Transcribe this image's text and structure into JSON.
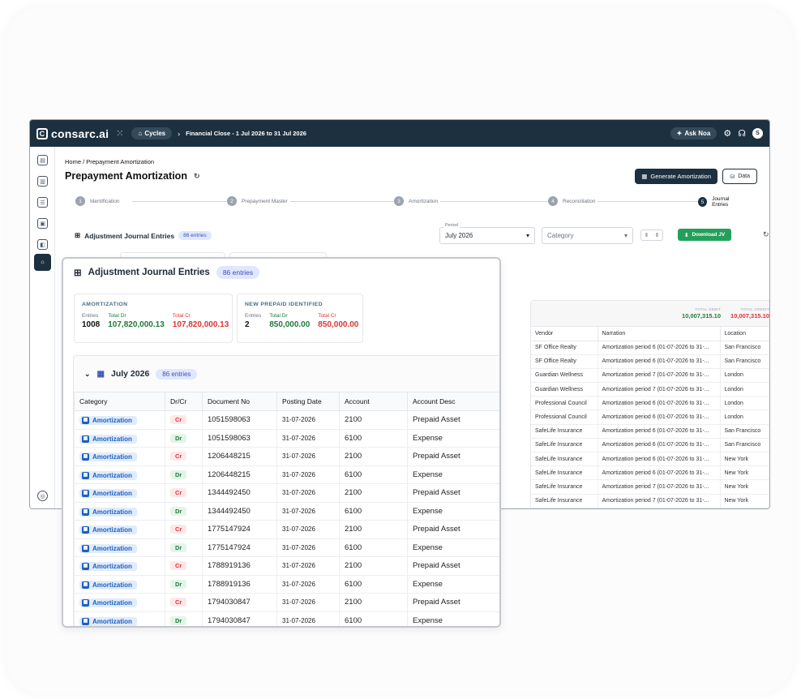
{
  "app": {
    "logo": "consarc.ai",
    "cycles_label": "Cycles",
    "crumb": "Financial Close - 1 Jul 2026 to 31 Jul 2026",
    "ask_noa": "Ask Noa",
    "avatar": "S"
  },
  "breadcrumb": "Home  /  Prepayment Amortization",
  "page_title": "Prepayment Amortization",
  "buttons": {
    "generate": "Generate Amortization",
    "data": "Data",
    "download": "Download JV"
  },
  "steps": [
    {
      "num": "1",
      "label": "Identification"
    },
    {
      "num": "2",
      "label": "Prepayment Master"
    },
    {
      "num": "3",
      "label": "Amortization"
    },
    {
      "num": "4",
      "label": "Reconciliation"
    },
    {
      "num": "5",
      "label": "Journal Entries"
    }
  ],
  "section": {
    "title": "Adjustment Journal Entries",
    "badge": "86 entries"
  },
  "filters": {
    "period_label": "Period",
    "period_value": "July 2026",
    "category_placeholder": "Category"
  },
  "totals": {
    "debit_label": "TOTAL DEBIT",
    "debit": "10,007,315.10",
    "credit_label": "TOTAL CREDIT",
    "credit": "10,007,315.10"
  },
  "right_table": {
    "headers": [
      "Vendor",
      "Narration",
      "Location"
    ],
    "rows": [
      [
        "SF Office Realty",
        "Amortization period 6 (01-07-2026 to 31-...",
        "San Francisco"
      ],
      [
        "SF Office Realty",
        "Amortization period 6 (01-07-2026 to 31-...",
        "San Francisco"
      ],
      [
        "Guardian Wellness",
        "Amortization period 7 (01-07-2026 to 31-...",
        "London"
      ],
      [
        "Guardian Wellness",
        "Amortization period 7 (01-07-2026 to 31-...",
        "London"
      ],
      [
        "Professional Council",
        "Amortization period 6 (01-07-2026 to 31-...",
        "London"
      ],
      [
        "Professional Council",
        "Amortization period 6 (01-07-2026 to 31-...",
        "London"
      ],
      [
        "SafeLife Insurance",
        "Amortization period 6 (01-07-2026 to 31-...",
        "San Francisco"
      ],
      [
        "SafeLife Insurance",
        "Amortization period 6 (01-07-2026 to 31-...",
        "San Francisco"
      ],
      [
        "SafeLife Insurance",
        "Amortization period 6 (01-07-2026 to 31-...",
        "New York"
      ],
      [
        "SafeLife Insurance",
        "Amortization period 6 (01-07-2026 to 31-...",
        "New York"
      ],
      [
        "SafeLife Insurance",
        "Amortization period 7 (01-07-2026 to 31-...",
        "New York"
      ],
      [
        "SafeLife Insurance",
        "Amortization period 7 (01-07-2026 to 31-...",
        "New York"
      ]
    ]
  },
  "card": {
    "title": "Adjustment Journal Entries",
    "badge": "86 entries",
    "amortization": {
      "heading": "AMORTIZATION",
      "entries_label": "Entries",
      "entries": "1008",
      "dr_label": "Total Dr",
      "dr": "107,820,000.13",
      "cr_label": "Total Cr",
      "cr": "107,820,000.13"
    },
    "new_prepaid": {
      "heading": "NEW PREPAID IDENTIFIED",
      "entries_label": "Entries",
      "entries": "2",
      "dr_label": "Total Dr",
      "dr": "850,000.00",
      "cr_label": "Total Cr",
      "cr": "850,000.00"
    },
    "group": {
      "label": "July 2026",
      "badge": "86 entries"
    },
    "headers": [
      "Category",
      "Dr/Cr",
      "Document No",
      "Posting Date",
      "Account",
      "Account Desc"
    ],
    "rows": [
      [
        "Amortization",
        "Cr",
        "1051598063",
        "31-07-2026",
        "2100",
        "Prepaid Asset"
      ],
      [
        "Amortization",
        "Dr",
        "1051598063",
        "31-07-2026",
        "6100",
        "Expense"
      ],
      [
        "Amortization",
        "Cr",
        "1206448215",
        "31-07-2026",
        "2100",
        "Prepaid Asset"
      ],
      [
        "Amortization",
        "Dr",
        "1206448215",
        "31-07-2026",
        "6100",
        "Expense"
      ],
      [
        "Amortization",
        "Cr",
        "1344492450",
        "31-07-2026",
        "2100",
        "Prepaid Asset"
      ],
      [
        "Amortization",
        "Dr",
        "1344492450",
        "31-07-2026",
        "6100",
        "Expense"
      ],
      [
        "Amortization",
        "Cr",
        "1775147924",
        "31-07-2026",
        "2100",
        "Prepaid Asset"
      ],
      [
        "Amortization",
        "Dr",
        "1775147924",
        "31-07-2026",
        "6100",
        "Expense"
      ],
      [
        "Amortization",
        "Cr",
        "1788919136",
        "31-07-2026",
        "2100",
        "Prepaid Asset"
      ],
      [
        "Amortization",
        "Dr",
        "1788919136",
        "31-07-2026",
        "6100",
        "Expense"
      ],
      [
        "Amortization",
        "Cr",
        "1794030847",
        "31-07-2026",
        "2100",
        "Prepaid Asset"
      ],
      [
        "Amortization",
        "Dr",
        "1794030847",
        "31-07-2026",
        "6100",
        "Expense"
      ]
    ]
  }
}
